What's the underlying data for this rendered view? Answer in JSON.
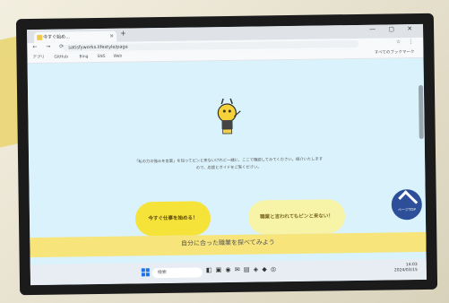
{
  "browser": {
    "tab_title": "今すぐ始め...",
    "tab_close": "×",
    "new_tab": "+",
    "window_controls": "— ▢ ✕",
    "nav": "← → ⟳",
    "url": "satisfyworks.lifestyle/page",
    "addr_right": "☆ ⋮",
    "bookmarks": [
      "アプリ",
      "GitHub",
      "Bing",
      "SNS",
      "Web"
    ],
    "bookmarks_all": "すべてのブックマーク"
  },
  "page": {
    "description": "「私の力の強みを言葉」を知ってピンと来ないけれど一緒に、ここで確認してみてください。紹介いたしますので、応援とガイドをご覧ください。",
    "primary_button": "今すぐ仕事を始める！",
    "secondary_button": "職業と言われてもピンと来ない！",
    "floating_label": "ページTOP",
    "bottom_title": "自分に合った職業を探べてみよう"
  },
  "taskbar": {
    "search_placeholder": "検索",
    "icons": "◧ ▣ ◉ ✉ ▤ ◈ ◆ ◎",
    "tray_time": "14:03",
    "tray_date": "2024/03/15"
  },
  "colors": {
    "accent_yellow": "#f6e33a",
    "page_bg": "#d9f2fb",
    "floating_blue": "#2d4f9a"
  }
}
